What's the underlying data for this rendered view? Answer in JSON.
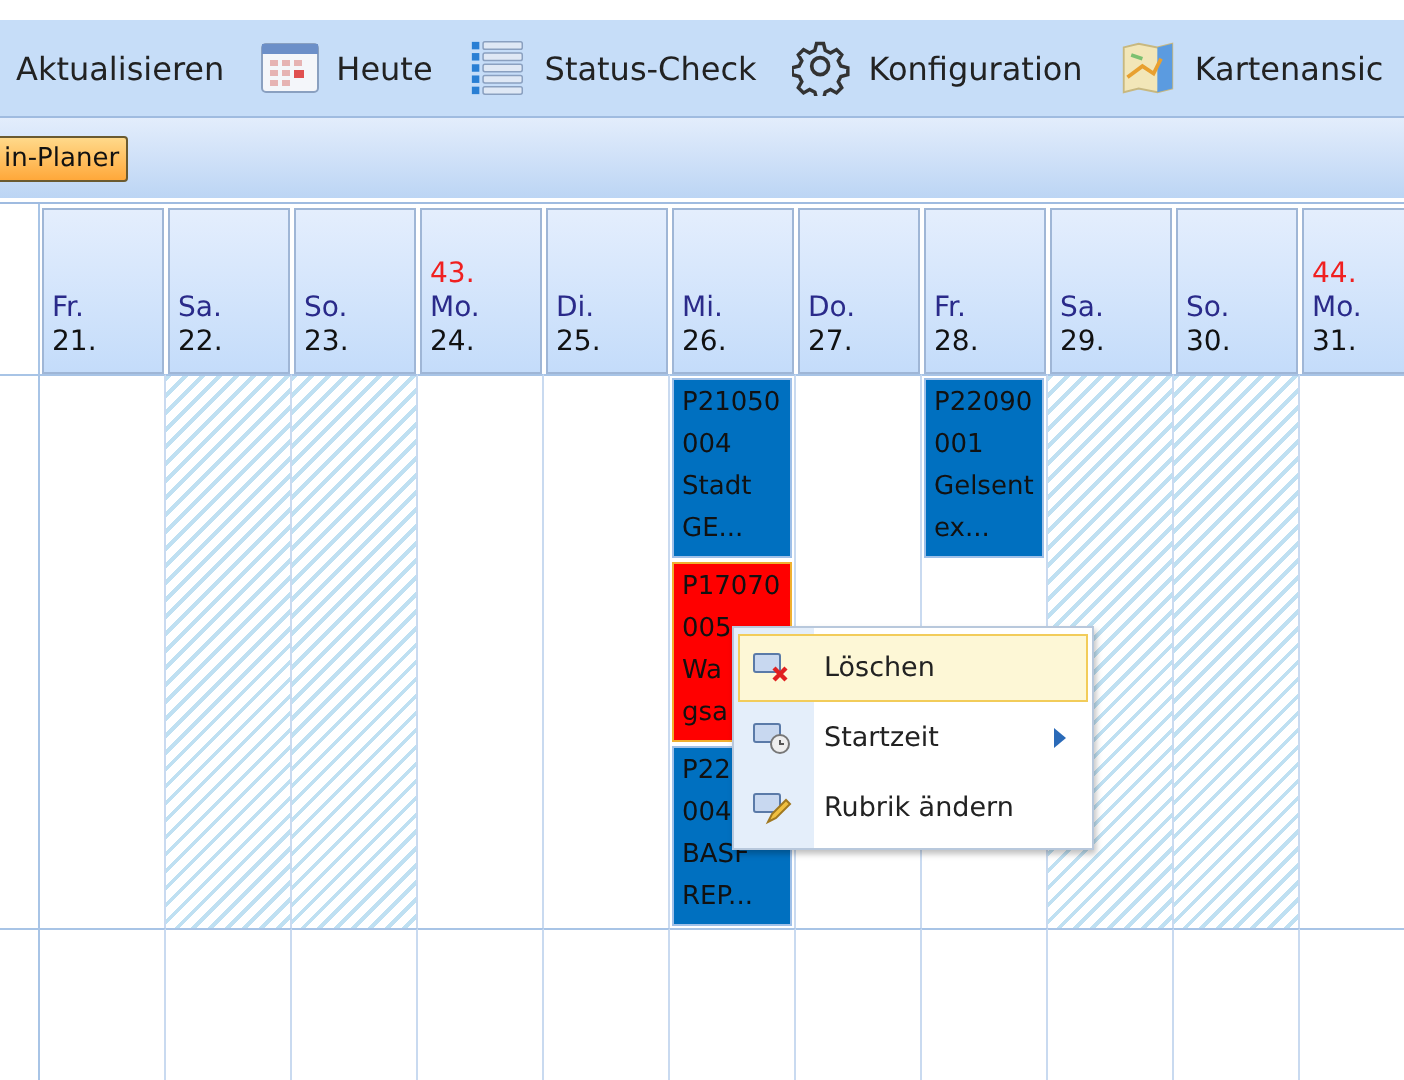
{
  "toolbar": [
    {
      "label": "Aktualisieren",
      "kind": "text"
    },
    {
      "label": "Heute",
      "kind": "calendar"
    },
    {
      "label": "Status-Check",
      "kind": "list"
    },
    {
      "label": "Konfiguration",
      "kind": "settings"
    },
    {
      "label": "Kartenansic",
      "kind": "map"
    }
  ],
  "tabs": [
    {
      "label": "in-Planer",
      "selected": true
    }
  ],
  "days": [
    {
      "weekday": "Fr.",
      "date": "21.",
      "weekend": false
    },
    {
      "weekday": "Sa.",
      "date": "22.",
      "weekend": true
    },
    {
      "weekday": "So.",
      "date": "23.",
      "weekend": true
    },
    {
      "week": "43.",
      "weekday": "Mo.",
      "date": "24.",
      "weekend": false
    },
    {
      "weekday": "Di.",
      "date": "25.",
      "weekend": false
    },
    {
      "weekday": "Mi.",
      "date": "26.",
      "weekend": false,
      "events": [
        {
          "lines": [
            "P21050",
            "004",
            "Stadt",
            "GE..."
          ],
          "color": "#0070c0",
          "selected": false
        },
        {
          "lines": [
            "P17070",
            "005",
            "Wa",
            "gsa"
          ],
          "color": "#ff0000",
          "selected": true
        },
        {
          "lines": [
            "P22",
            "004",
            "BASF",
            "REP..."
          ],
          "color": "#0070c0",
          "selected": false
        }
      ]
    },
    {
      "weekday": "Do.",
      "date": "27.",
      "weekend": false
    },
    {
      "weekday": "Fr.",
      "date": "28.",
      "weekend": false,
      "events": [
        {
          "lines": [
            "P22090",
            "001",
            "Gelsent",
            "ex..."
          ],
          "color": "#0070c0",
          "selected": false
        }
      ]
    },
    {
      "weekday": "Sa.",
      "date": "29.",
      "weekend": true
    },
    {
      "weekday": "So.",
      "date": "30.",
      "weekend": true
    },
    {
      "week": "44.",
      "weekday": "Mo.",
      "date": "31.",
      "weekend": false
    }
  ],
  "context_menu": [
    {
      "label": "Löschen",
      "kind": "delete",
      "selected": true,
      "submenu": false
    },
    {
      "label": "Startzeit",
      "kind": "time",
      "selected": false,
      "submenu": true
    },
    {
      "label": "Rubrik ändern",
      "kind": "edit",
      "selected": false,
      "submenu": false
    }
  ]
}
